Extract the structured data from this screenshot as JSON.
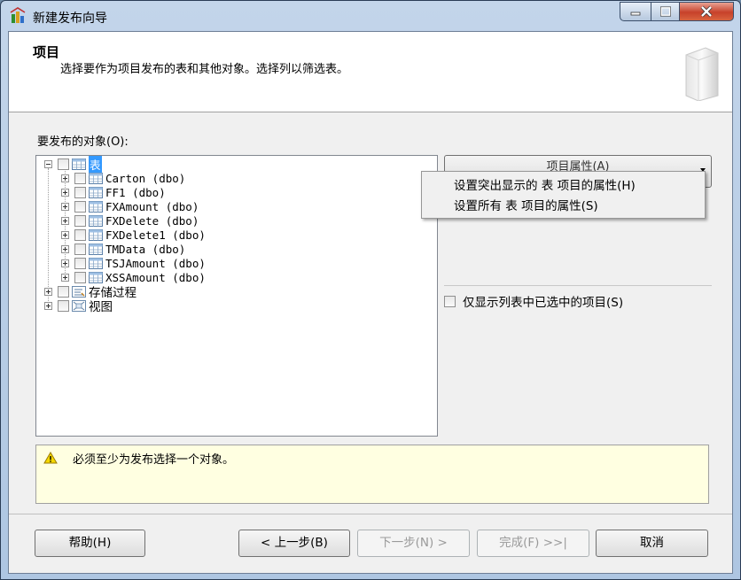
{
  "window": {
    "title": "新建发布向导"
  },
  "header": {
    "title": "项目",
    "description": "选择要作为项目发布的表和其他对象。选择列以筛选表。"
  },
  "objects_label": "要发布的对象(O):",
  "tree": {
    "root_label": "表",
    "tables": [
      "Carton (dbo)",
      "FF1 (dbo)",
      "FXAmount (dbo)",
      "FXDelete (dbo)",
      "FXDelete1 (dbo)",
      "TMData (dbo)",
      "TSJAmount (dbo)",
      "XSSAmount (dbo)"
    ],
    "stored_procedures_label": "存储过程",
    "views_label": "视图"
  },
  "properties_button": {
    "label": "项目属性(A)"
  },
  "context_menu": {
    "items": [
      "设置突出显示的 表 项目的属性(H)",
      "设置所有 表 项目的属性(S)"
    ]
  },
  "show_selected_only_label": "仅显示列表中已选中的项目(S)",
  "warning": {
    "text": "必须至少为发布选择一个对象。"
  },
  "buttons": {
    "help": "帮助(H)",
    "back": "< 上一步(B)",
    "next": "下一步(N) >",
    "finish": "完成(F) >>|",
    "cancel": "取消"
  },
  "colors": {
    "selection": "#3399ff",
    "warning_background": "#ffffe1",
    "title_bar": "#c3d5ea",
    "close_button": "#c7412a"
  },
  "icons": {
    "app": "wizard-app-icon",
    "table": "table-icon",
    "stored_procedure": "stored-procedure-icon",
    "view": "view-icon",
    "warning": "warning-icon"
  }
}
